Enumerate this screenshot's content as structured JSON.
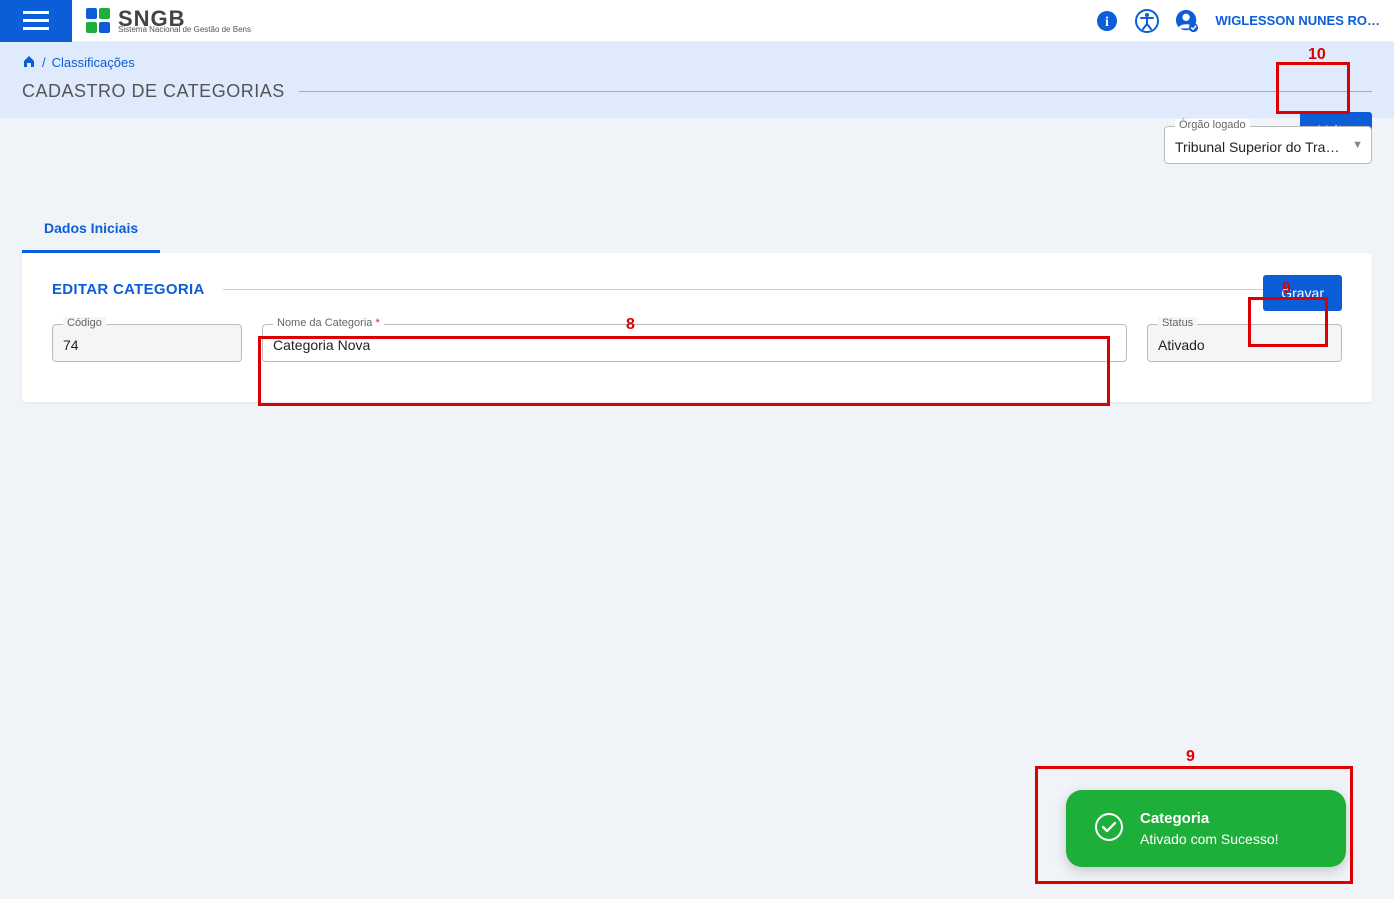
{
  "header": {
    "logo_main": "SNGB",
    "logo_sub": "Sistema Nacional de Gestão de Bens",
    "username": "WIGLESSON NUNES RO…"
  },
  "breadcrumb": {
    "link": "Classificações",
    "title": "CADASTRO DE CATEGORIAS",
    "voltar": "Voltar"
  },
  "orgao": {
    "label": "Órgão logado",
    "value": "Tribunal Superior do Tra…"
  },
  "tabs": {
    "dados_iniciais": "Dados Iniciais"
  },
  "card": {
    "title": "EDITAR CATEGORIA",
    "gravar": "Gravar",
    "codigo_label": "Código",
    "codigo_value": "74",
    "nome_label": "Nome da Categoria",
    "nome_value": "Categoria Nova",
    "status_label": "Status",
    "status_value": "Ativado"
  },
  "toast": {
    "title": "Categoria",
    "message": "Ativado com Sucesso!"
  },
  "annotations": {
    "a8": "8",
    "a9": "9",
    "a9b": "9",
    "a10": "10"
  }
}
